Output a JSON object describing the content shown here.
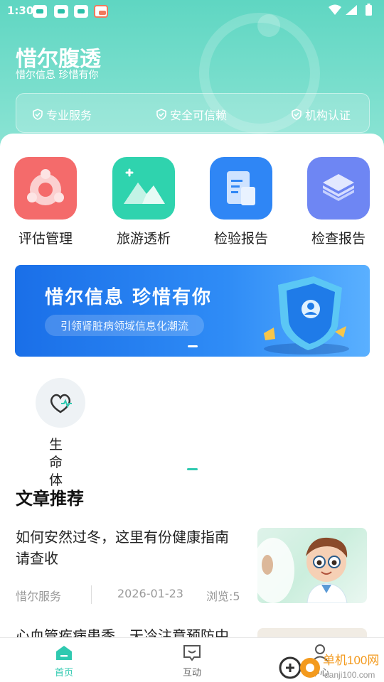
{
  "status_bar": {
    "time": "1:30"
  },
  "header": {
    "title": "惜尔腹透",
    "subtitle": "惜尔信息 珍惜有你",
    "features": [
      "专业服务",
      "安全可信赖",
      "机构认证"
    ]
  },
  "quick_actions": [
    {
      "label": "评估管理",
      "icon": "assessment-icon",
      "color": "#f46b6b"
    },
    {
      "label": "旅游透析",
      "icon": "mountain-image-icon",
      "color": "#2fd3ae"
    },
    {
      "label": "检验报告",
      "icon": "document-icon",
      "color": "#2f86f5"
    },
    {
      "label": "检查报告",
      "icon": "layers-icon",
      "color": "#6e86f3"
    }
  ],
  "banner": {
    "title": "惜尔信息 珍惜有你",
    "subtitle": "引领肾脏病领域信息化潮流"
  },
  "vitals": {
    "label": "生命体",
    "icon": "heart-pulse-icon"
  },
  "articles_section": {
    "title": "文章推荐",
    "items": [
      {
        "title": "如何安然过冬，这里有份健康指南请查收",
        "source": "惜尔服务",
        "date": "2026-01-23",
        "views": "浏览:5"
      },
      {
        "title": "心血管疾病患季，天冷注意预防中"
      }
    ]
  },
  "tab_bar": {
    "items": [
      {
        "label": "首页",
        "icon": "home-icon",
        "active": true
      },
      {
        "label": "互动",
        "icon": "chat-icon",
        "active": false
      },
      {
        "label": "中心",
        "icon": "user-icon",
        "active": false
      }
    ]
  },
  "watermark": {
    "text": "单机100网",
    "url": "danji100.com"
  },
  "colors": {
    "accent": "#2fc9b0",
    "header": "#6fdac8"
  }
}
